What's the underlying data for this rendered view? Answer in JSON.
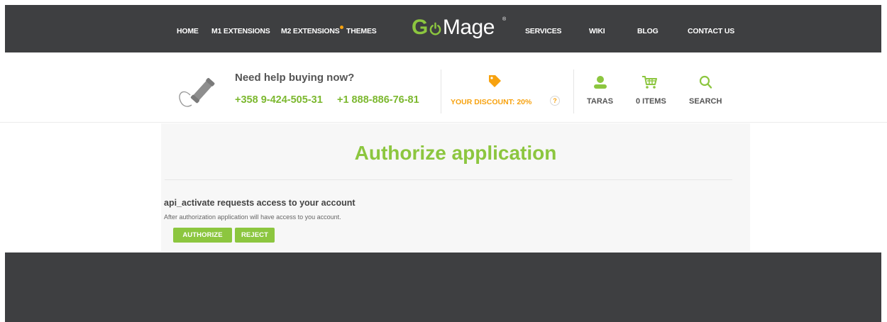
{
  "nav": {
    "items": [
      {
        "label": "HOME"
      },
      {
        "label": "M1 EXTENSIONS"
      },
      {
        "label": "M2 EXTENSIONS"
      },
      {
        "label": "THEMES"
      },
      {
        "label": "SERVICES"
      },
      {
        "label": "WIKI"
      },
      {
        "label": "BLOG"
      },
      {
        "label": "CONTACT US"
      }
    ],
    "logo": {
      "g": "G",
      "mage": "Mage",
      "reg": "®"
    }
  },
  "help": {
    "title": "Need help buying now?",
    "phone1": "+358 9-424-505-31",
    "phone2": "+1 888-886-76-81"
  },
  "discount": {
    "label": "YOUR DISCOUNT: 20%",
    "help": "?"
  },
  "account": {
    "user": "TARAS",
    "cart": "0 ITEMS",
    "search": "SEARCH"
  },
  "auth": {
    "title": "Authorize application",
    "request": "api_activate requests access to your account",
    "description": "After authorization application will have access to you account.",
    "authorize_label": "AUTHORIZE",
    "reject_label": "REJECT"
  },
  "colors": {
    "accent": "#8cc63f",
    "orange": "#f7a20f",
    "dark": "#3e3f41"
  }
}
